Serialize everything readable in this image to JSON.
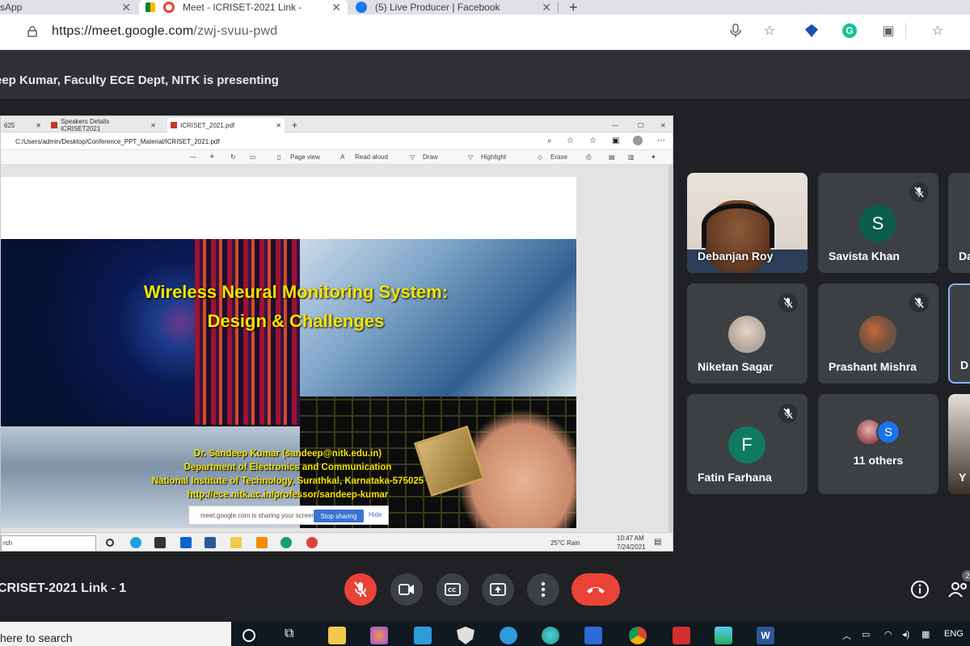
{
  "browser": {
    "tabs": [
      {
        "label": "sApp",
        "active": false
      },
      {
        "label": "Meet - ICRISET-2021 Link -",
        "active": true
      },
      {
        "label": "(5) Live Producer | Facebook",
        "active": false
      }
    ],
    "new_tab_label": "+",
    "url_host": "https://meet.google.com",
    "url_path": "/zwj-svuu-pwd"
  },
  "meet": {
    "presenting_text": "eep Kumar, Faculty ECE Dept, NITK is presenting",
    "meeting_name": "CRISET-2021 Link - 1",
    "people_count": "2"
  },
  "shared_screen": {
    "tabs": [
      {
        "label": "625"
      },
      {
        "label": "Speakers Details ICRISET2021"
      },
      {
        "label": "ICRISET_2021.pdf"
      }
    ],
    "address": "C:/Users/admin/Desktop/Conference_PPT_Material/ICRISET_2021.pdf",
    "toolbar": {
      "minus": "—",
      "plus": "+",
      "page_view": "Page view",
      "read_aloud": "Read aloud",
      "draw": "Draw",
      "highlight": "Highlight",
      "erase": "Erase"
    },
    "slide": {
      "title_line1": "Wireless Neural Monitoring System:",
      "title_line2": "Design & Challenges",
      "info_lines": [
        "Dr. Sandeep Kumar (sandeep@nitk.edu.in)",
        "Department of Electronics and Communication",
        "National Institute of Technology, Surathkal, Karnataka-575025",
        "http://ece.nitk.ac.in/professor/sandeep-kumar"
      ]
    },
    "share_banner": {
      "text": "meet.google.com is sharing your screen.",
      "stop": "Stop sharing",
      "hide": "Hide"
    },
    "taskbar": {
      "search": "rch",
      "weather": "25°C  Rain",
      "time": "10:47 AM",
      "date": "7/24/2021"
    }
  },
  "participants": [
    {
      "name": "Debanjan Roy",
      "type": "video",
      "muted": false
    },
    {
      "name": "Savista Khan",
      "initial": "S",
      "color": "#0b5d4b",
      "muted": true
    },
    {
      "name": "Da",
      "type": "partial",
      "muted": false
    },
    {
      "name": "Niketan Sagar",
      "type": "photo",
      "muted": true
    },
    {
      "name": "Prashant Mishra",
      "type": "photo",
      "muted": true
    },
    {
      "name": "D",
      "type": "partial",
      "muted": false
    },
    {
      "name": "Fatin Farhana",
      "initial": "F",
      "color": "#0f7a62",
      "muted": true
    },
    {
      "name": "11 others",
      "type": "others",
      "initial": "S",
      "color": "#1a73e8"
    },
    {
      "name": "Y",
      "type": "partial"
    }
  ],
  "taskbar": {
    "search_text": "here to search",
    "lang": "ENG"
  },
  "colors": {
    "meet_bg": "#202124",
    "red": "#ea4335",
    "slide_yellow": "#f5e400"
  }
}
